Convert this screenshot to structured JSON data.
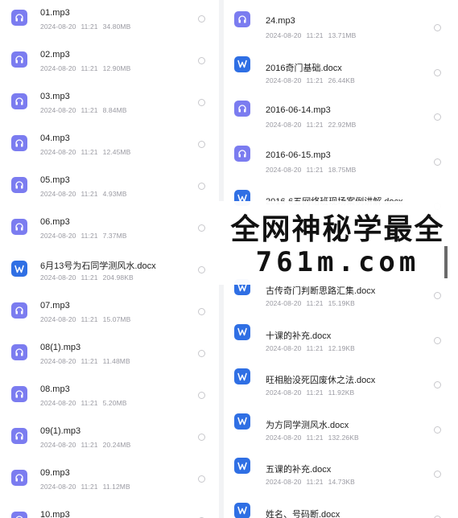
{
  "left_files": [
    {
      "name": "01.mp3",
      "date": "2024-08-20",
      "time": "11:21",
      "size": "34.80MB",
      "type": "mp3"
    },
    {
      "name": "02.mp3",
      "date": "2024-08-20",
      "time": "11:21",
      "size": "12.90MB",
      "type": "mp3"
    },
    {
      "name": "03.mp3",
      "date": "2024-08-20",
      "time": "11:21",
      "size": "8.84MB",
      "type": "mp3"
    },
    {
      "name": "04.mp3",
      "date": "2024-08-20",
      "time": "11:21",
      "size": "12.45MB",
      "type": "mp3"
    },
    {
      "name": "05.mp3",
      "date": "2024-08-20",
      "time": "11:21",
      "size": "4.93MB",
      "type": "mp3"
    },
    {
      "name": "06.mp3",
      "date": "2024-08-20",
      "time": "11:21",
      "size": "7.37MB",
      "type": "mp3"
    },
    {
      "name": "6月13号为石同学测风水.docx",
      "date": "2024-08-20",
      "time": "11:21",
      "size": "204.98KB",
      "type": "docx"
    },
    {
      "name": "07.mp3",
      "date": "2024-08-20",
      "time": "11:21",
      "size": "15.07MB",
      "type": "mp3"
    },
    {
      "name": "08(1).mp3",
      "date": "2024-08-20",
      "time": "11:21",
      "size": "11.48MB",
      "type": "mp3"
    },
    {
      "name": "08.mp3",
      "date": "2024-08-20",
      "time": "11:21",
      "size": "5.20MB",
      "type": "mp3"
    },
    {
      "name": "09(1).mp3",
      "date": "2024-08-20",
      "time": "11:21",
      "size": "20.24MB",
      "type": "mp3"
    },
    {
      "name": "09.mp3",
      "date": "2024-08-20",
      "time": "11:21",
      "size": "11.12MB",
      "type": "mp3"
    },
    {
      "name": "10.mp3",
      "date": "",
      "time": "",
      "size": "",
      "type": "mp3"
    }
  ],
  "right_files": [
    {
      "name": "24.mp3",
      "date": "2024-08-20",
      "time": "11:21",
      "size": "13.71MB",
      "type": "mp3"
    },
    {
      "name": "2016奇门基础.docx",
      "date": "2024-08-20",
      "time": "11:21",
      "size": "26.44KB",
      "type": "docx"
    },
    {
      "name": "2016-06-14.mp3",
      "date": "2024-08-20",
      "time": "11:21",
      "size": "22.92MB",
      "type": "mp3"
    },
    {
      "name": "2016-06-15.mp3",
      "date": "2024-08-20",
      "time": "11:21",
      "size": "18.75MB",
      "type": "mp3"
    },
    {
      "name": "2016-6五网络班现场案例讲解.docx",
      "date": "",
      "time": "",
      "size": "",
      "type": "docx"
    },
    {
      "name": "",
      "date": "",
      "time": "",
      "size": "",
      "type": "none"
    },
    {
      "name": "古传奇门判断思路汇集.docx",
      "date": "2024-08-20",
      "time": "11:21",
      "size": "15.19KB",
      "type": "docx"
    },
    {
      "name": "十课的补充.docx",
      "date": "2024-08-20",
      "time": "11:21",
      "size": "12.19KB",
      "type": "docx"
    },
    {
      "name": "旺相胎没死囚废休之法.docx",
      "date": "2024-08-20",
      "time": "11:21",
      "size": "11.92KB",
      "type": "docx"
    },
    {
      "name": "为方同学测风水.docx",
      "date": "2024-08-20",
      "time": "11:21",
      "size": "132.26KB",
      "type": "docx"
    },
    {
      "name": "五课的补充.docx",
      "date": "2024-08-20",
      "time": "11:21",
      "size": "14.73KB",
      "type": "docx"
    },
    {
      "name": "姓名、号码断.docx",
      "date": "",
      "time": "",
      "size": "",
      "type": "docx"
    }
  ],
  "watermark": {
    "line1": "全网神秘学最全",
    "line2": "761m.com"
  },
  "colors": {
    "mp3_icon": "#7b7cf0",
    "docx_icon": "#2f6fe4"
  },
  "icons": {
    "mp3": "headphones-icon",
    "docx": "word-doc-icon"
  }
}
